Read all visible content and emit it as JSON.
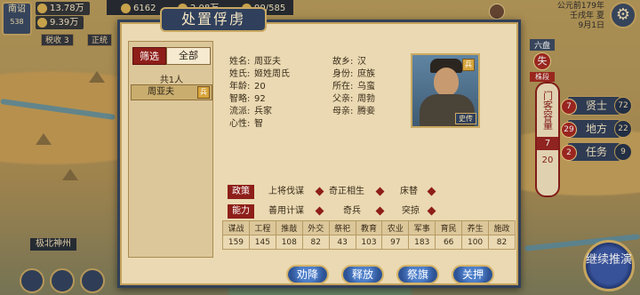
{
  "hud": {
    "city": {
      "name": "南诏",
      "code": "538"
    },
    "resources": [
      {
        "icon": "gold-icon",
        "value": "13.78万"
      },
      {
        "icon": "grain-icon",
        "value": "9.39万"
      },
      {
        "icon": "troops-icon",
        "value": "6162"
      },
      {
        "icon": "food-icon",
        "value": "2.08万"
      },
      {
        "icon": "population-icon",
        "value": "90/585"
      }
    ],
    "mini_tags": [
      "税收 3",
      "正统"
    ],
    "date": {
      "line1": "公元前179年",
      "line2": "壬戌年 夏",
      "line3": "9月1日"
    },
    "ruler_side": {
      "tag": "六盘",
      "name": "失",
      "sub": "株段"
    }
  },
  "right_panel": {
    "banner_label": "门客容量",
    "banner_used": "7",
    "banner_total": "20",
    "buttons": [
      {
        "num": "7",
        "label": "贤士",
        "side": "72"
      },
      {
        "num": "29",
        "label": "地方",
        "side": "22"
      },
      {
        "num": "2",
        "label": "任务",
        "side": "9"
      }
    ],
    "continue_label": "继续推演"
  },
  "map": {
    "place": "极北神州"
  },
  "dialog": {
    "title": "处置俘虏",
    "filter_label": "筛选",
    "all_label": "全部",
    "total_label": "共1人",
    "list": [
      {
        "name": "周亚夫",
        "badge": "兵"
      }
    ],
    "profile": {
      "left": [
        {
          "k": "姓名:",
          "v": "周亚夫"
        },
        {
          "k": "姓氏:",
          "v": "姬姓周氏"
        },
        {
          "k": "年龄:",
          "v": "20"
        },
        {
          "k": "智略:",
          "v": "92"
        },
        {
          "k": "流派:",
          "v": "兵家"
        },
        {
          "k": "心性:",
          "v": "智"
        }
      ],
      "right": [
        {
          "k": "故乡:",
          "v": "汉"
        },
        {
          "k": "身份:",
          "v": "庶族"
        },
        {
          "k": "所在:",
          "v": "乌蛮"
        },
        {
          "k": "父亲:",
          "v": "周勃"
        },
        {
          "k": "母亲:",
          "v": "腾妾"
        }
      ],
      "portrait_badge": "兵",
      "portrait_tag": "史传"
    },
    "strategies": {
      "cat": "政策",
      "items": [
        "上将伐谋",
        "奇正相生",
        "床替"
      ]
    },
    "abilities": {
      "cat": "能力",
      "items": [
        "善用计谋",
        "奇兵",
        "突掠"
      ]
    },
    "stats": {
      "headers": [
        "谋战",
        "工程",
        "推敲",
        "外交",
        "祭祀",
        "教育",
        "农业",
        "军事",
        "育民",
        "养生",
        "施政"
      ],
      "values": [
        "159",
        "145",
        "108",
        "82",
        "43",
        "103",
        "97",
        "183",
        "66",
        "100",
        "82"
      ]
    },
    "actions": [
      "劝降",
      "释放",
      "祭旗",
      "关押"
    ]
  }
}
